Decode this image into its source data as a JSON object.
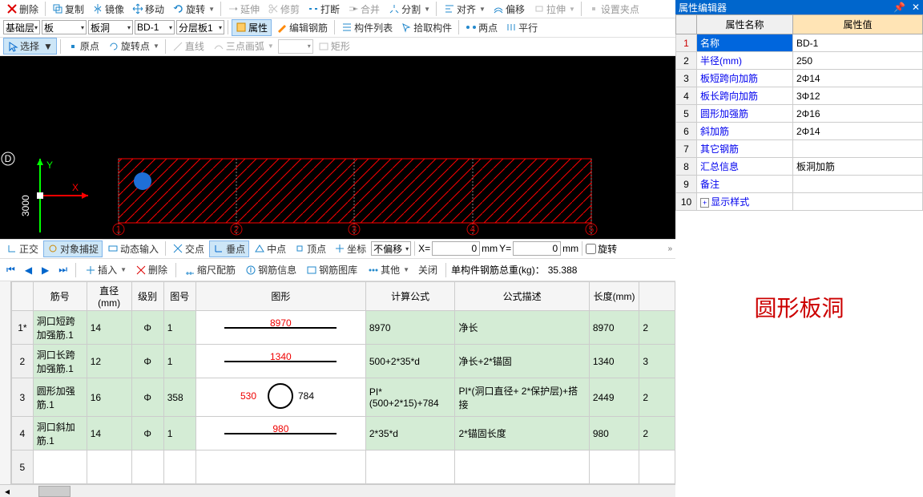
{
  "toolbar1": {
    "delete": "删除",
    "copy": "复制",
    "mirror": "镜像",
    "move": "移动",
    "rotate": "旋转",
    "extend": "延伸",
    "trim": "修剪",
    "break": "打断",
    "merge": "合并",
    "split": "分割",
    "align": "对齐",
    "offset": "偏移",
    "stretch": "拉伸",
    "set_grip": "设置夹点"
  },
  "toolbar2": {
    "layer": "基础层",
    "comp1": "板",
    "comp2": "板洞",
    "comp3": "BD-1",
    "comp4": "分层板1",
    "props": "属性",
    "edit_rebar": "编辑钢筋",
    "comp_list": "构件列表",
    "pick_comp": "拾取构件",
    "two_point": "两点",
    "parallel": "平行"
  },
  "toolbar3": {
    "select": "选择",
    "origin": "原点",
    "rotate_pt": "旋转点",
    "line": "直线",
    "arc3pt": "三点画弧",
    "rect": "矩形"
  },
  "statusbar": {
    "ortho": "正交",
    "osnap": "对象捕捉",
    "dyn_input": "动态输入",
    "intersect": "交点",
    "perp": "垂点",
    "mid": "中点",
    "vertex": "顶点",
    "coord": "坐标",
    "no_offset": "不偏移",
    "x_label": "X=",
    "x_val": "0",
    "x_unit": "mm",
    "y_label": "Y=",
    "y_val": "0",
    "y_unit": "mm",
    "rotate": "旋转"
  },
  "rebar_toolbar": {
    "insert": "插入",
    "delete": "删除",
    "scale_rebar": "缩尺配筋",
    "rebar_info": "钢筋信息",
    "rebar_lib": "钢筋图库",
    "other": "其他",
    "close": "关闭",
    "weight_label": "单构件钢筋总重(kg)：",
    "weight_val": "35.388"
  },
  "rebar_headers": [
    "筋号",
    "直径(mm)",
    "级别",
    "图号",
    "图形",
    "计算公式",
    "公式描述",
    "长度(mm)",
    ""
  ],
  "rebar_rows": [
    {
      "n": "1*",
      "name": "洞口短跨加强筋.1",
      "dia": "14",
      "grade": "Φ",
      "fig": "1",
      "shape_val": "8970",
      "formula": "8970",
      "desc": "净长",
      "len": "8970",
      "cnt": "2"
    },
    {
      "n": "2",
      "name": "洞口长跨加强筋.1",
      "dia": "12",
      "grade": "Φ",
      "fig": "1",
      "shape_val": "1340",
      "formula": "500+2*35*d",
      "desc": "净长+2*锚固",
      "len": "1340",
      "cnt": "3"
    },
    {
      "n": "3",
      "name": "圆形加强筋.1",
      "dia": "16",
      "grade": "Φ",
      "fig": "358",
      "shape_val": "530",
      "shape_val2": "784",
      "formula": "PI*(500+2*15)+784",
      "desc": "PI*(洞口直径+ 2*保护层)+搭接",
      "len": "2449",
      "cnt": "2"
    },
    {
      "n": "4",
      "name": "洞口斜加筋.1",
      "dia": "14",
      "grade": "Φ",
      "fig": "1",
      "shape_val": "980",
      "formula": "2*35*d",
      "desc": "2*锚固长度",
      "len": "980",
      "cnt": "2"
    },
    {
      "n": "5",
      "name": "",
      "dia": "",
      "grade": "",
      "fig": "",
      "shape_val": "",
      "formula": "",
      "desc": "",
      "len": "",
      "cnt": ""
    }
  ],
  "canvas": {
    "d_label": "D",
    "y_label": "Y",
    "x_label": "X",
    "dim_3000": "3000",
    "grid_nums": [
      "1",
      "2",
      "3",
      "4",
      "5"
    ]
  },
  "prop_editor": {
    "title": "属性编辑器",
    "col_name": "属性名称",
    "col_value": "属性值",
    "rows": [
      {
        "n": "1",
        "name": "名称",
        "val": "BD-1"
      },
      {
        "n": "2",
        "name": "半径(mm)",
        "val": "250"
      },
      {
        "n": "3",
        "name": "板短跨向加筋",
        "val": "2Φ14"
      },
      {
        "n": "4",
        "name": "板长跨向加筋",
        "val": "3Φ12"
      },
      {
        "n": "5",
        "name": "圆形加强筋",
        "val": "2Φ16"
      },
      {
        "n": "6",
        "name": "斜加筋",
        "val": "2Φ14"
      },
      {
        "n": "7",
        "name": "其它钢筋",
        "val": ""
      },
      {
        "n": "8",
        "name": "汇总信息",
        "val": "板洞加筋"
      },
      {
        "n": "9",
        "name": "备注",
        "val": ""
      },
      {
        "n": "10",
        "name": "显示样式",
        "val": ""
      }
    ]
  },
  "watermark": "圆形板洞"
}
